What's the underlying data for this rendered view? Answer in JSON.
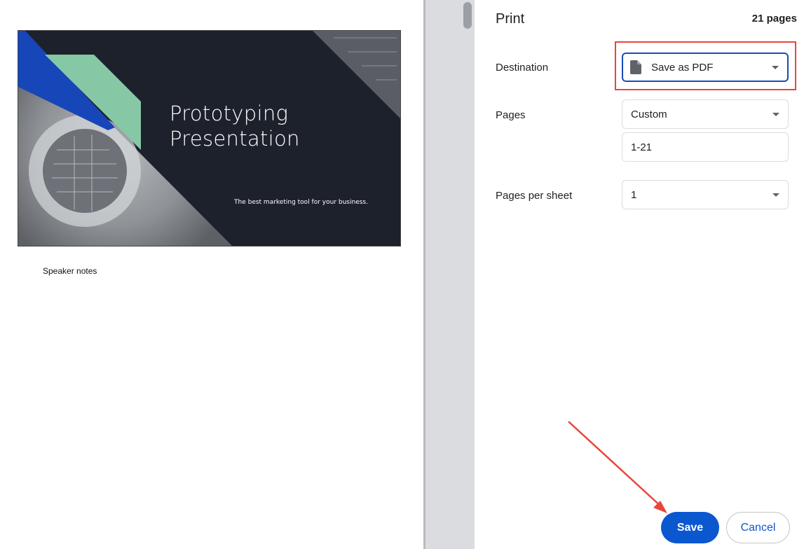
{
  "preview": {
    "slide": {
      "title_line1": "Prototyping",
      "title_line2": "Presentation",
      "subtitle": "The best marketing tool for your business."
    },
    "speaker_notes": "Speaker notes"
  },
  "panel": {
    "title": "Print",
    "page_count": "21 pages",
    "destination": {
      "label": "Destination",
      "value": "Save as PDF",
      "icon": "file-icon"
    },
    "pages": {
      "label": "Pages",
      "value": "Custom",
      "range_value": "1-21"
    },
    "pages_per_sheet": {
      "label": "Pages per sheet",
      "value": "1"
    },
    "save_label": "Save",
    "cancel_label": "Cancel"
  },
  "colors": {
    "accent": "#0b57d0",
    "highlight": "#e8463b",
    "slide_bg": "#1d212b",
    "slide_green": "#86c8a6",
    "slide_blue": "#1746b8"
  }
}
